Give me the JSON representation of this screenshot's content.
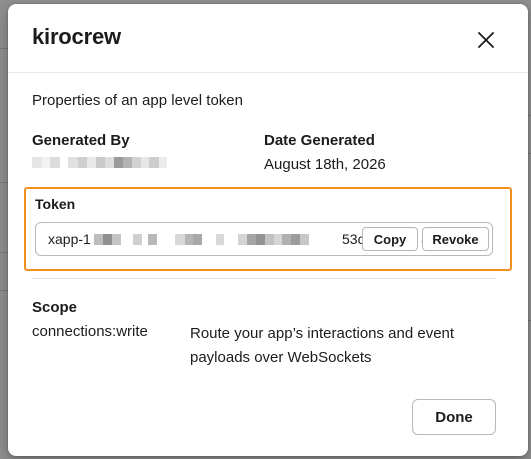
{
  "dialog": {
    "title": "kirocrew",
    "close_icon": "close-icon",
    "subtitle": "Properties of an app level token"
  },
  "details": {
    "generated_by_label": "Generated By",
    "date_generated_label": "Date Generated",
    "date_generated_value": "August 18th, 2026"
  },
  "token": {
    "label": "Token",
    "value_prefix": "xapp-1",
    "value_suffix": "53c",
    "value_tail": "3",
    "copy_label": "Copy",
    "revoke_label": "Revoke",
    "highlight_color": "#f2901f"
  },
  "scope": {
    "label": "Scope",
    "name": "connections:write",
    "description": "Route your app’s interactions and event payloads over WebSockets"
  },
  "footer": {
    "done_label": "Done"
  }
}
